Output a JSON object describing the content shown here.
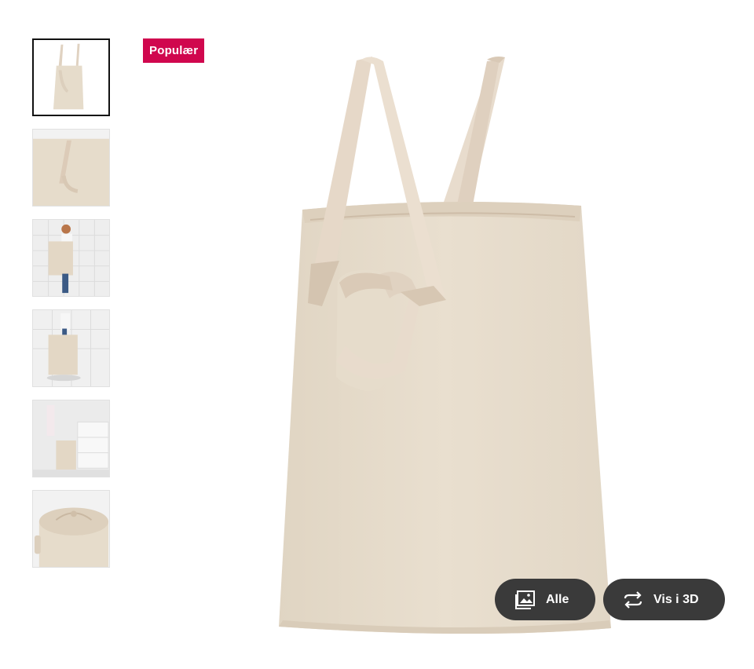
{
  "badge": {
    "label": "Populær",
    "color": "#d0074e"
  },
  "thumbnails": [
    {
      "name": "thumb-bag-front",
      "active": true
    },
    {
      "name": "thumb-bag-closeup",
      "active": false
    },
    {
      "name": "thumb-person-carrying-bag",
      "active": false
    },
    {
      "name": "thumb-bag-in-room",
      "active": false
    },
    {
      "name": "thumb-bag-in-bathroom",
      "active": false
    },
    {
      "name": "thumb-bag-drawstring-top",
      "active": false
    }
  ],
  "buttons": {
    "all": {
      "label": "Alle",
      "icon": "image-gallery-icon"
    },
    "view3d": {
      "label": "Vis i 3D",
      "icon": "rotate-3d-icon"
    }
  },
  "colors": {
    "button_bg": "#3a3a3a",
    "fabric": "#e6dccb",
    "strap": "#e2d3c2"
  }
}
